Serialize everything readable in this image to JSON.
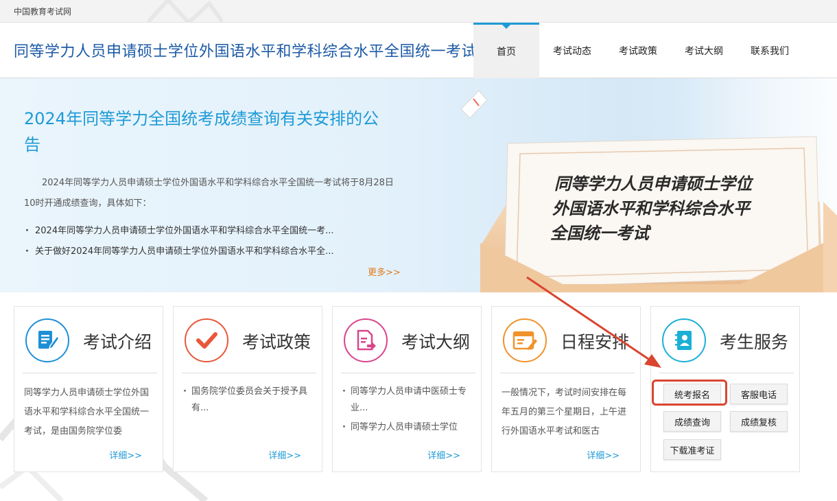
{
  "topbar": {
    "site_name": "中国教育考试网"
  },
  "header": {
    "title": "同等学力人员申请硕士学位外国语水平和学科综合水平全国统一考试"
  },
  "nav": [
    {
      "label": "首页"
    },
    {
      "label": "考试动态"
    },
    {
      "label": "考试政策"
    },
    {
      "label": "考试大纲"
    },
    {
      "label": "联系我们"
    }
  ],
  "banner": {
    "title": "2024年同等学力全国统考成绩查询有关安排的公告",
    "desc": "2024年同等学力人员申请硕士学位外国语水平和学科综合水平全国统一考试将于8月28日10时开通成绩查询，具体如下：",
    "list": [
      "2024年同等学力人员申请硕士学位外国语水平和学科综合水平全国统一考...",
      "关于做好2024年同等学力人员申请硕士学位外国语水平和学科综合水平全..."
    ],
    "more": "更多>>",
    "art_lines": [
      "同等学力人员申请硕士学位",
      "外国语水平和学科综合水平",
      "全国统一考试"
    ]
  },
  "cards": {
    "intro": {
      "title": "考试介绍",
      "text": "同等学力人员申请硕士学位外国语水平和学科综合水平全国统一考试，是由国务院学位委",
      "more": "详细>>",
      "icon": "document-pen-icon",
      "color": "#1e8fd6"
    },
    "policy": {
      "title": "考试政策",
      "items": [
        "国务院学位委员会关于授予具有..."
      ],
      "more": "详细>>",
      "icon": "checkmark-icon",
      "color": "#e8573a"
    },
    "syllabus": {
      "title": "考试大纲",
      "items": [
        "同等学力人员申请中医硕士专业...",
        "同等学力人员申请硕士学位"
      ],
      "more": "详细>>",
      "icon": "file-export-icon",
      "color": "#d9458a"
    },
    "schedule": {
      "title": "日程安排",
      "text": "一般情况下，考试时间安排在每年五月的第三个星期日，上午进行外国语水平考试和医古",
      "more": "详细>>",
      "icon": "calendar-edit-icon",
      "color": "#f0922a"
    },
    "service": {
      "title": "考生服务",
      "icon": "contact-book-icon",
      "color": "#1ab0d6",
      "buttons": [
        "统考报名",
        "客服电话",
        "成绩查询",
        "成绩复核",
        "下载准考证"
      ]
    }
  },
  "annotation": {
    "highlight_color": "#d9452f"
  }
}
